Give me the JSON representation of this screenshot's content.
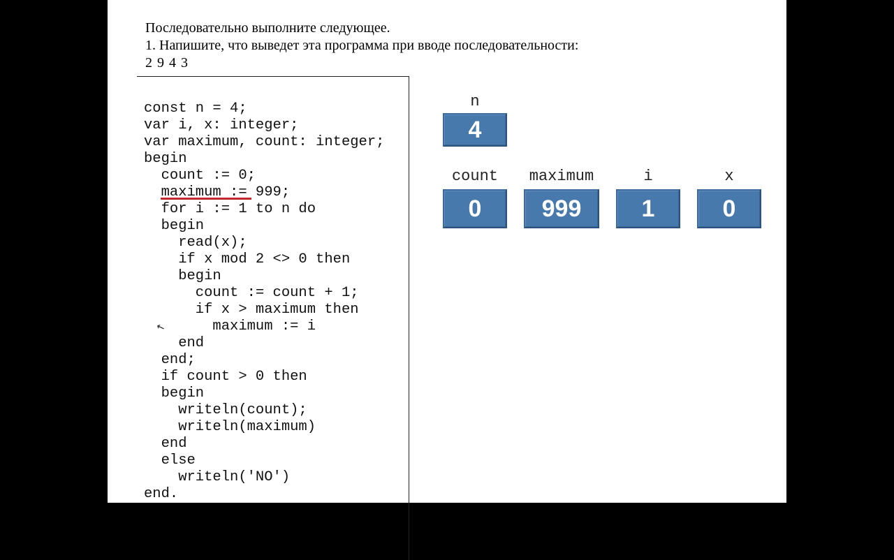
{
  "header": {
    "line1": "Последовательно выполните следующее.",
    "line2": "1. Напишите, что выведет эта программа при вводе последовательности:",
    "input_sequence": "2 9 4 3"
  },
  "code": {
    "lines": [
      "const n = 4;",
      "var i, x: integer;",
      "var maximum, count: integer;",
      "begin",
      "  count := 0;",
      "  maximum := 999;",
      "  for i := 1 to n do",
      "  begin",
      "    read(x);",
      "    if x mod 2 <> 0 then",
      "    begin",
      "      count := count + 1;",
      "      if x > maximum then",
      "        maximum := i",
      "    end",
      "  end;",
      "  if count > 0 then",
      "  begin",
      "    writeln(count);",
      "    writeln(maximum)",
      "  end",
      "  else",
      "    writeln('NO')",
      "end."
    ],
    "highlight_text": "for i := 1"
  },
  "variables": {
    "n": {
      "label": "n",
      "value": "4"
    },
    "count": {
      "label": "count",
      "value": "0"
    },
    "maximum": {
      "label": "maximum",
      "value": "999"
    },
    "i": {
      "label": "i",
      "value": "1"
    },
    "x": {
      "label": "x",
      "value": "0"
    }
  },
  "cursor_glyph": "↖"
}
